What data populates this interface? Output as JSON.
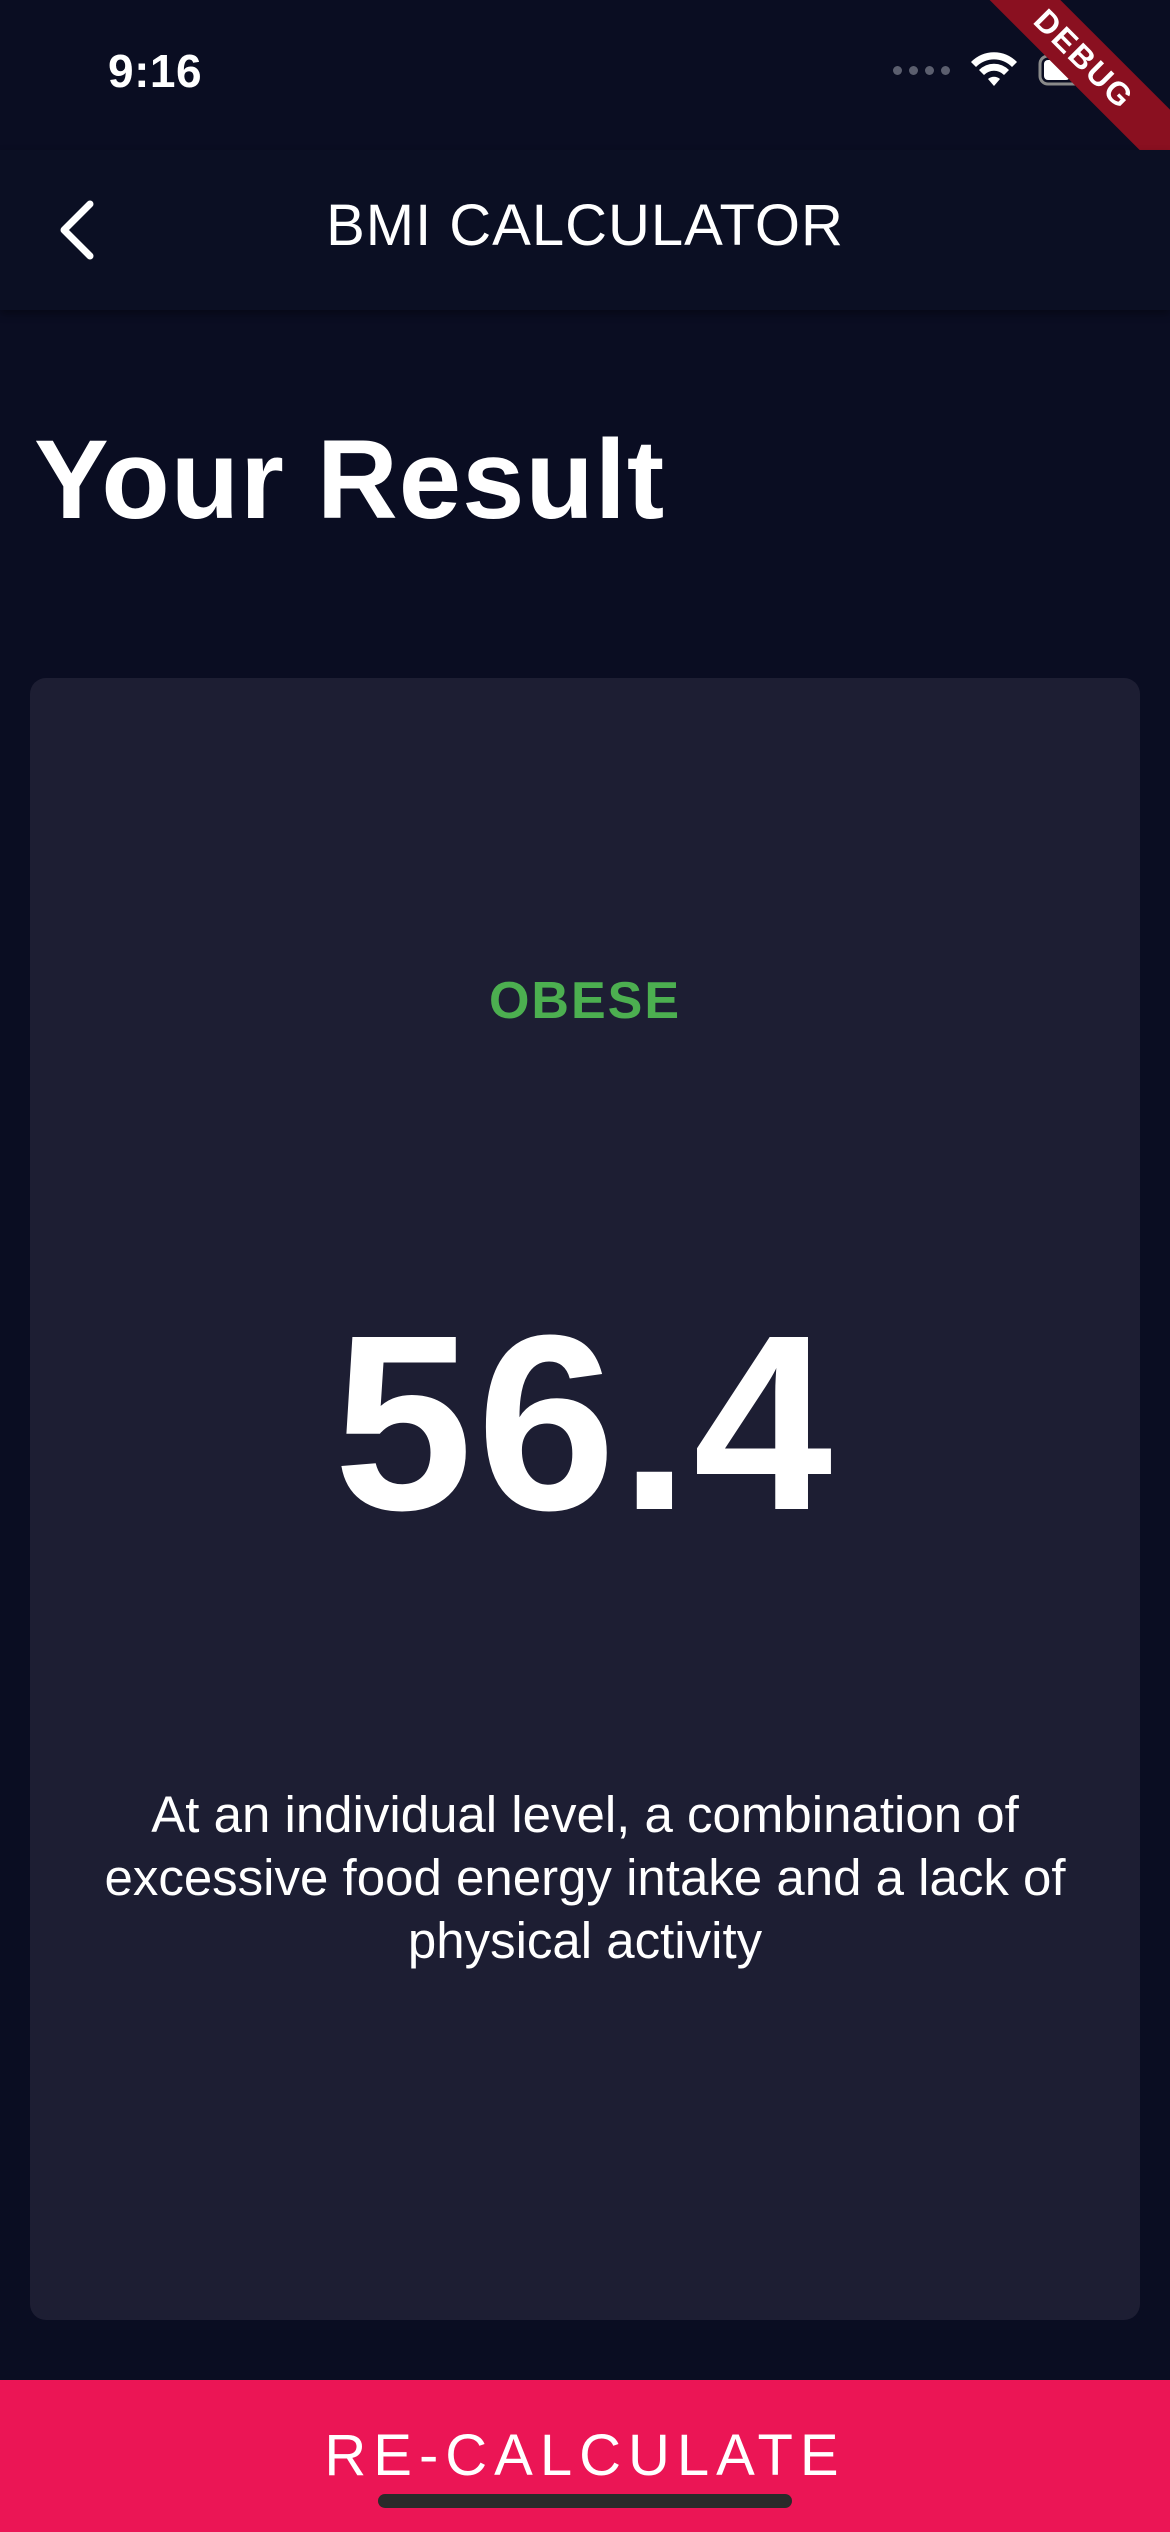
{
  "status_bar": {
    "time": "9:16",
    "debug_label": "DEBUG"
  },
  "app_bar": {
    "title": "BMI CALCULATOR",
    "back_icon": "chevron-left-icon"
  },
  "page": {
    "title": "Your Result"
  },
  "result": {
    "status": "OBESE",
    "status_color": "#4caf50",
    "bmi": "56.4",
    "interpretation": "At an individual level, a combination of excessive food energy intake and a lack of physical activity"
  },
  "footer": {
    "recalculate_label": "RE-CALCULATE",
    "button_color": "#eb1555"
  },
  "colors": {
    "background": "#0a0d22",
    "card": "#1d1e33"
  }
}
